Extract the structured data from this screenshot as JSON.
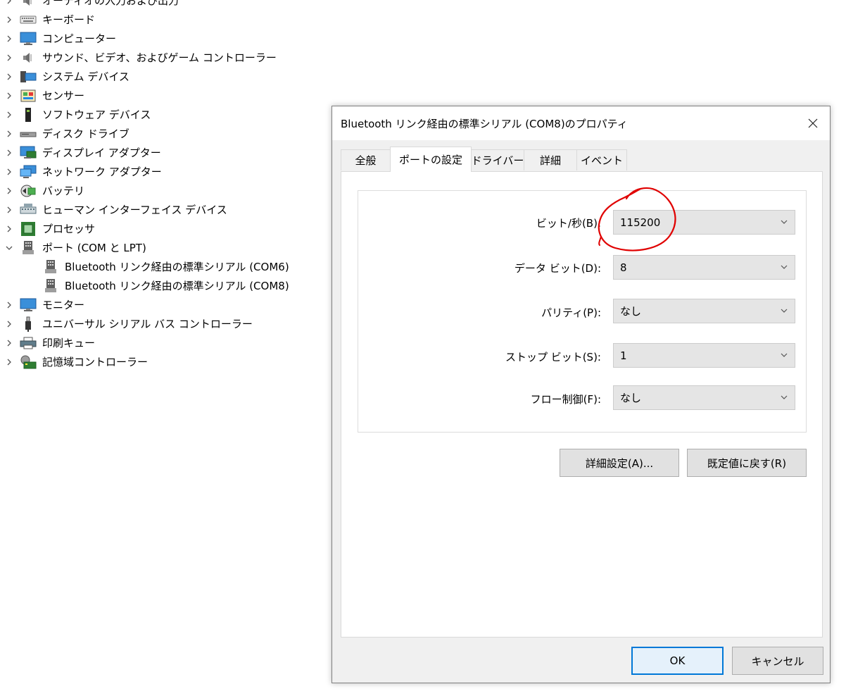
{
  "device_tree": [
    {
      "label": "オーディオの入力および出力",
      "icon": "speaker-icon",
      "expanded": false,
      "child": false
    },
    {
      "label": "キーボード",
      "icon": "keyboard-icon",
      "expanded": false,
      "child": false
    },
    {
      "label": "コンピューター",
      "icon": "computer-icon",
      "expanded": false,
      "child": false
    },
    {
      "label": "サウンド、ビデオ、およびゲーム コントローラー",
      "icon": "speaker-icon",
      "expanded": false,
      "child": false
    },
    {
      "label": "システム デバイス",
      "icon": "system-device-icon",
      "expanded": false,
      "child": false
    },
    {
      "label": "センサー",
      "icon": "sensor-icon",
      "expanded": false,
      "child": false
    },
    {
      "label": "ソフトウェア デバイス",
      "icon": "software-device-icon",
      "expanded": false,
      "child": false
    },
    {
      "label": "ディスク ドライブ",
      "icon": "disk-drive-icon",
      "expanded": false,
      "child": false
    },
    {
      "label": "ディスプレイ アダプター",
      "icon": "display-adapter-icon",
      "expanded": false,
      "child": false
    },
    {
      "label": "ネットワーク アダプター",
      "icon": "network-adapter-icon",
      "expanded": false,
      "child": false
    },
    {
      "label": "バッテリ",
      "icon": "battery-icon",
      "expanded": false,
      "child": false
    },
    {
      "label": "ヒューマン インターフェイス デバイス",
      "icon": "hid-icon",
      "expanded": false,
      "child": false
    },
    {
      "label": "プロセッサ",
      "icon": "processor-icon",
      "expanded": false,
      "child": false
    },
    {
      "label": "ポート (COM と LPT)",
      "icon": "port-icon",
      "expanded": true,
      "child": false
    },
    {
      "label": "Bluetooth リンク経由の標準シリアル (COM6)",
      "icon": "port-icon",
      "expanded": false,
      "child": true
    },
    {
      "label": "Bluetooth リンク経由の標準シリアル (COM8)",
      "icon": "port-icon",
      "expanded": false,
      "child": true
    },
    {
      "label": "モニター",
      "icon": "monitor-icon",
      "expanded": false,
      "child": false
    },
    {
      "label": "ユニバーサル シリアル バス コントローラー",
      "icon": "usb-icon",
      "expanded": false,
      "child": false
    },
    {
      "label": "印刷キュー",
      "icon": "printer-icon",
      "expanded": false,
      "child": false
    },
    {
      "label": "記憶域コントローラー",
      "icon": "storage-controller-icon",
      "expanded": false,
      "child": false
    }
  ],
  "dialog": {
    "title": "Bluetooth リンク経由の標準シリアル (COM8)のプロパティ",
    "tabs": [
      "全般",
      "ポートの設定",
      "ドライバー",
      "詳細",
      "イベント"
    ],
    "active_tab": "ポートの設定",
    "fields": [
      {
        "label": "ビット/秒(B):",
        "value": "115200"
      },
      {
        "label": "データ ビット(D):",
        "value": "8"
      },
      {
        "label": "パリティ(P):",
        "value": "なし"
      },
      {
        "label": "ストップ ビット(S):",
        "value": "1"
      },
      {
        "label": "フロー制御(F):",
        "value": "なし"
      }
    ],
    "advanced_button": "詳細設定(A)...",
    "restore_defaults_button": "既定値に戻す(R)",
    "ok_button": "OK",
    "cancel_button": "キャンセル"
  },
  "colors": {
    "annotation": "#e00000",
    "default_button_border": "#0078d7"
  }
}
